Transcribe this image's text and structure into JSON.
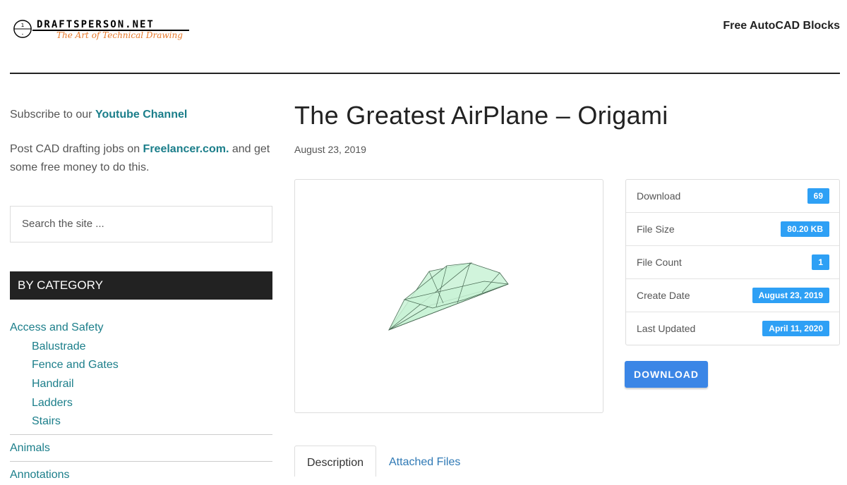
{
  "header": {
    "logo_title": "DRAFTSPERSON.NET",
    "logo_tagline": "The Art of Technical Drawing",
    "nav_link": "Free AutoCAD Blocks"
  },
  "sidebar": {
    "subscribe_prefix": "Subscribe to our ",
    "subscribe_link": "Youtube Channel",
    "post_prefix": "Post CAD drafting jobs on ",
    "post_link": "Freelancer.com.",
    "post_suffix": " and get some free money to do this.",
    "search_placeholder": "Search the site ...",
    "category_heading": "BY CATEGORY",
    "categories": [
      {
        "label": "Access and Safety"
      },
      {
        "label": "Balustrade"
      },
      {
        "label": "Fence and Gates"
      },
      {
        "label": "Handrail"
      },
      {
        "label": "Ladders"
      },
      {
        "label": "Stairs"
      },
      {
        "label": "Animals"
      },
      {
        "label": "Annotations"
      }
    ]
  },
  "main": {
    "title": "The Greatest AirPlane – Origami",
    "date": "August 23, 2019",
    "info": [
      {
        "label": "Download",
        "value": "69"
      },
      {
        "label": "File Size",
        "value": "80.20 KB"
      },
      {
        "label": "File Count",
        "value": "1"
      },
      {
        "label": "Create Date",
        "value": "August 23, 2019"
      },
      {
        "label": "Last Updated",
        "value": "April 11, 2020"
      }
    ],
    "download_button": "DOWNLOAD",
    "tabs": [
      {
        "label": "Description"
      },
      {
        "label": "Attached Files"
      }
    ]
  },
  "colors": {
    "link": "#1b7e8a",
    "badge": "#2ea0f5",
    "button": "#3b86e6",
    "category_bar": "#222222"
  }
}
